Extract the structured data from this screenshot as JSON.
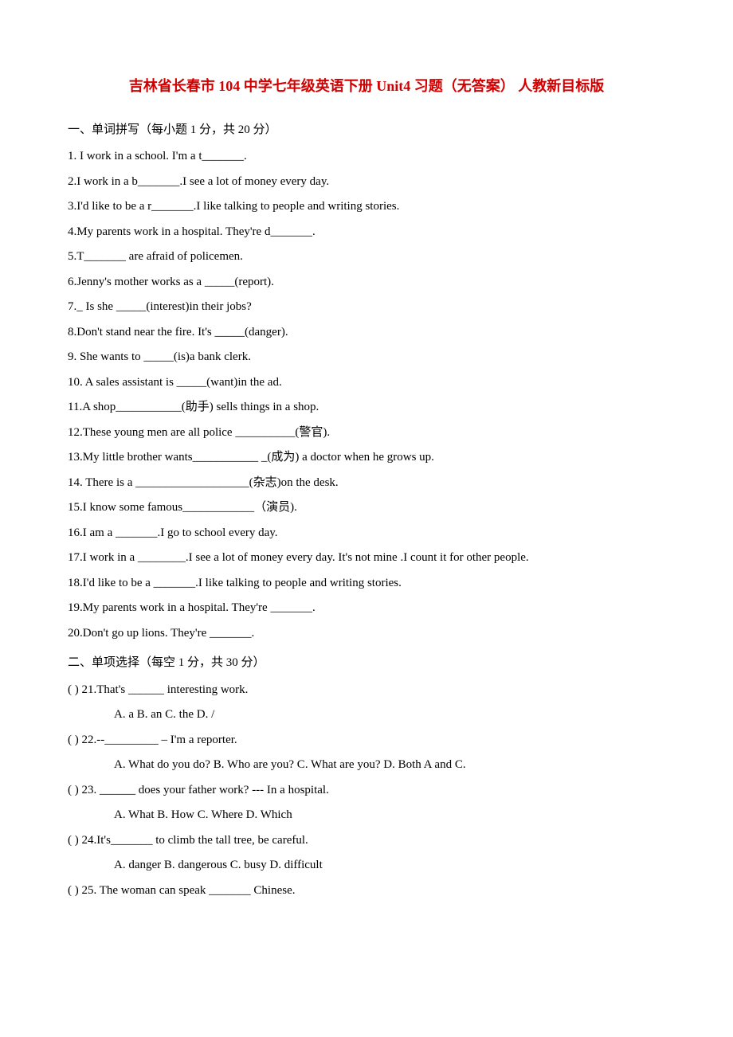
{
  "title": "吉林省长春市 104 中学七年级英语下册 Unit4 习题（无答案） 人教新目标版",
  "section1": {
    "header": "一、单词拼写（每小题 1 分，共 20 分）",
    "q1": "1. I work in a school. I'm a t_______.",
    "q2": "2.I work in a b_______.I see a lot of money every day.",
    "q3": "3.I'd like to be a r_______.I like talking to people and writing stories.",
    "q4": "4.My parents work in a hospital. They're d_______.",
    "q5": "5.T_______ are afraid of policemen.",
    "q6": "6.Jenny's mother works as a _____(report).",
    "q7": "7._ Is she _____(interest)in their jobs?",
    "q8": "8.Don't stand near the fire. It's _____(danger).",
    "q9": "9. She wants to _____(is)a bank clerk.",
    "q10": "10. A sales assistant is _____(want)in the ad.",
    "q11": "11.A shop___________(助手) sells things in a shop.",
    "q12": "12.These young men are all police __________(警官).",
    "q13": "13.My little brother wants___________ _(成为) a doctor when he grows up.",
    "q14": "14. There is a ___________________(杂志)on the desk.",
    "q15": "15.I know some famous____________（演员).",
    "q16": "16.I am a _______.I go to school every day.",
    "q17": "17.I work in a ________.I see a lot of money every day. It's not mine .I count it for other people.",
    "q18": "18.I'd like to be a _______.I like talking to people and writing stories.",
    "q19": "19.My parents work in a hospital. They're _______.",
    "q20": "20.Don't go up lions. They're _______."
  },
  "section2": {
    "header": "二、单项选择（每空 1 分，共 30 分）",
    "q21": "(   ) 21.That's ______ interesting work.",
    "q21opts": "A. a     B. an     C. the     D. /",
    "q22": "(   ) 22.--_________  – I'm a reporter.",
    "q22opts": "A. What do you do?  B. Who are you?  C. What are you?  D. Both A and C.",
    "q23": "(   ) 23. ______ does your father work?  --- In a hospital.",
    "q23opts": "A. What    B. How    C. Where    D. Which",
    "q24": "(   ) 24.It's_______ to climb the tall tree, be careful.",
    "q24opts": "A. danger    B. dangerous    C. busy    D. difficult",
    "q25": "(   ) 25. The woman can speak _______ Chinese."
  }
}
